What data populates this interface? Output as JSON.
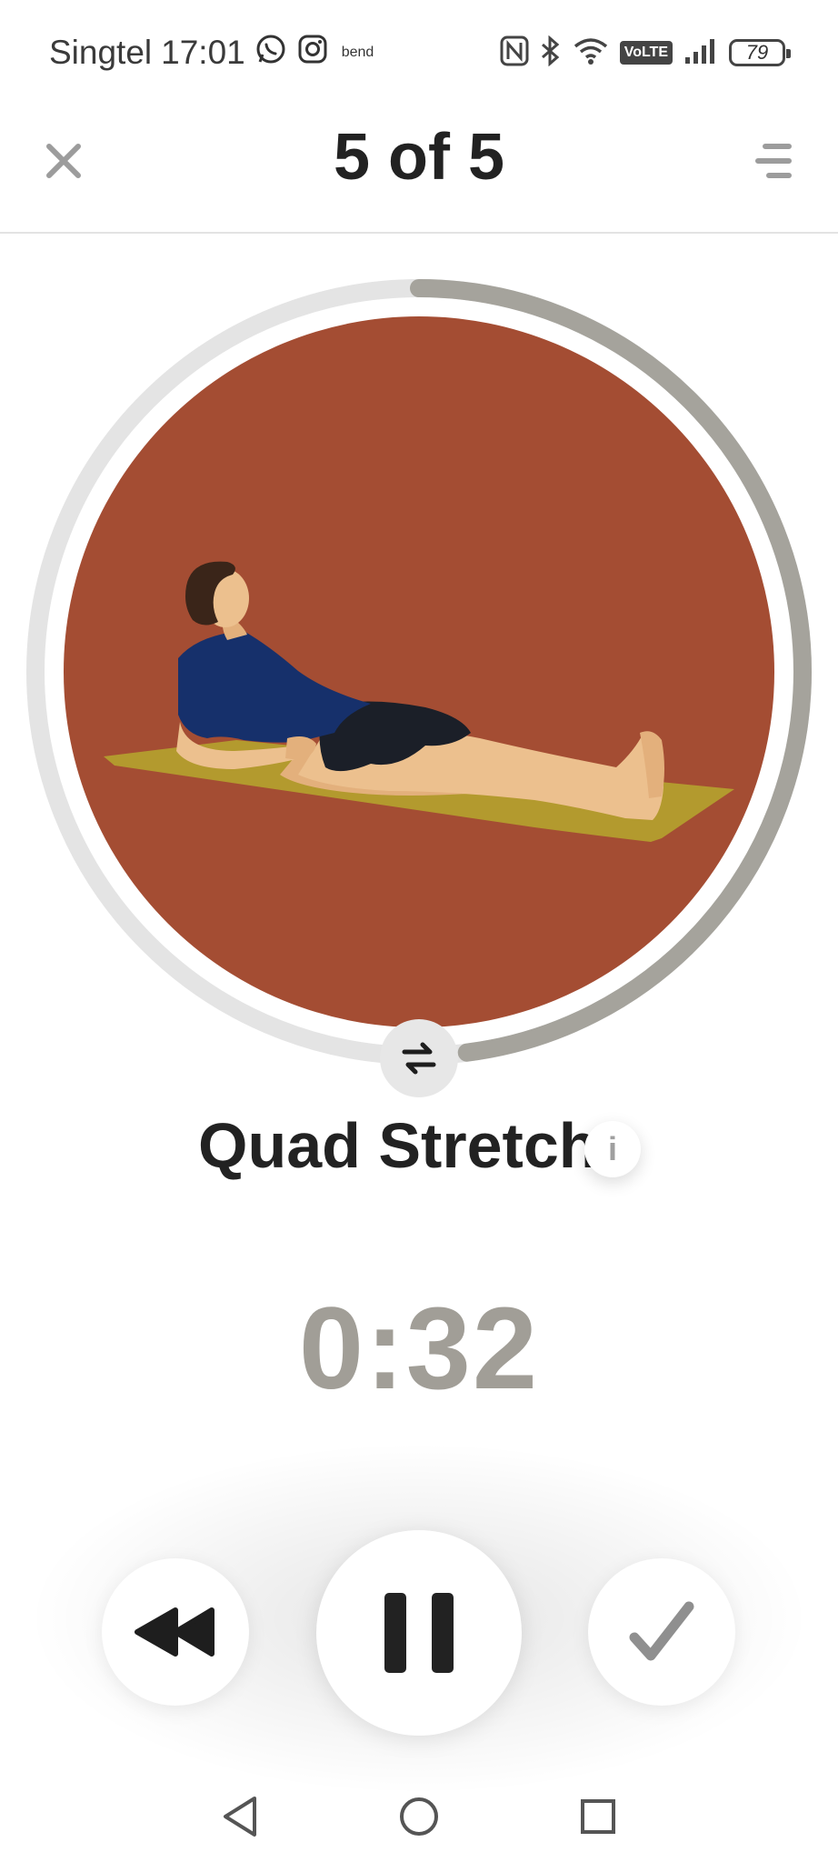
{
  "status_bar": {
    "carrier": "Singtel",
    "time": "17:01",
    "notification_app_label": "bend",
    "battery_level": "79",
    "icons": [
      "whatsapp-icon",
      "instagram-icon",
      "nfc-icon",
      "bluetooth-icon",
      "wifi-icon",
      "volte-badge",
      "signal-icon",
      "battery-icon"
    ],
    "volte_label": "VoLTE"
  },
  "header": {
    "title": "5 of 5",
    "close_icon": "close-icon",
    "menu_icon": "menu-icon"
  },
  "exercise": {
    "name": "Quad Stretch",
    "illustration": "person-reclining-on-mat",
    "swap_icon": "swap-sides-icon",
    "info_label": "i",
    "progress_fraction": 0.48
  },
  "timer": {
    "value": "0:32"
  },
  "controls": {
    "rewind_icon": "rewind-icon",
    "pause_icon": "pause-icon",
    "done_icon": "checkmark-icon"
  },
  "nav_bar": {
    "icons": [
      "back-icon",
      "home-icon",
      "recents-icon"
    ]
  },
  "colors": {
    "illustration_bg": "#a44d33",
    "ring_track": "#e4e4e4",
    "ring_progress": "#a5a39c",
    "timer_text": "#a19e97",
    "mat": "#b39a2e",
    "shirt": "#16306b",
    "skin": "#ecc08e"
  }
}
